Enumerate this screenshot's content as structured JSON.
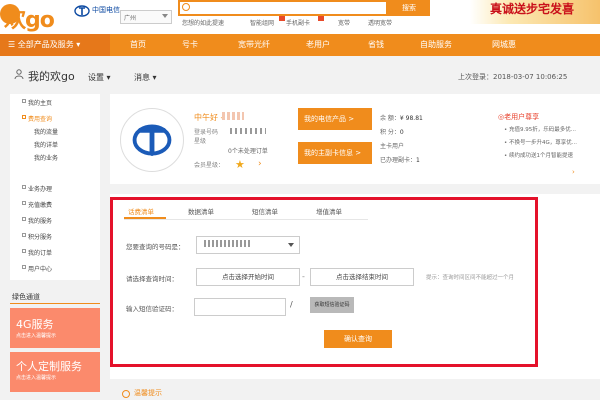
{
  "header": {
    "logo": "欢go",
    "carrier": "中国电信",
    "city": "广州",
    "search_button": "搜索",
    "hot_links": [
      "您想的如此提速",
      "智能组网",
      "手机副卡",
      "宽带",
      "透明宽带"
    ],
    "banner": "真诚送步宅发喜"
  },
  "nav": {
    "all_products": "全部产品及服务",
    "items": [
      "首页",
      "号卡",
      "宽带光纤",
      "老用户",
      "省钱",
      "自助服务",
      "网城惠"
    ]
  },
  "subheader": {
    "my_go": "我的欢go",
    "settings": "设置",
    "messages": "消息",
    "last_login": "上次登录：2018-03-07 10:06:25"
  },
  "sidebar": {
    "items": [
      "我的主页",
      "费用查询",
      "我的流量",
      "我的详单",
      "我的业务",
      "业务办理",
      "充值缴费",
      "我的服务",
      "积分服务",
      "我的订单",
      "用户中心"
    ],
    "active_index": 1,
    "green_channel": "绿色通道",
    "promos": [
      {
        "title": "4G服务",
        "subtitle": "点击进入温馨提示"
      },
      {
        "title": "个人定制服务",
        "subtitle": "点击进入温馨提示"
      }
    ]
  },
  "account": {
    "greeting": "中午好 - ",
    "login_id_label": "登录号码",
    "star_label": "星级",
    "pending": "个未处理订单",
    "pending_count": "0",
    "member_level": "会员星级：",
    "btn_products": "我的电信产品  >",
    "btn_card": "我的主副卡信息 >",
    "balance_label": "余  额：",
    "balance": "¥ 98.81",
    "points_label": "积  分：",
    "points": "0",
    "card_label": "主卡用户",
    "invoice_label": "已办理副卡：",
    "invoice_count": "1",
    "old_user_title": "◎老用户尊享",
    "old_user_items": [
      "• 充值9.95折，乐码最多优...",
      "• 不换号一步升4G，尊享优...",
      "• 续约成功送1个月智能提速"
    ],
    "more_arrow": "›"
  },
  "query": {
    "tabs": [
      "话费清单",
      "数据清单",
      "短信清单",
      "增值清单"
    ],
    "active_tab": 0,
    "number_label": "您要查询的号码是：",
    "date_label": "请选择查询时间：",
    "start_date": "点击选择开始时间",
    "end_date": "点击选择结束时间",
    "date_sep": "-",
    "hint": "提示：查询时间区间不能超过一个月",
    "sms_label": "输入短信验证码：",
    "get_code": "获取短信验证码",
    "confirm": "确认查询"
  },
  "footer": {
    "warm_tip": "温馨提示"
  },
  "colors": {
    "brand": "#f08c1c",
    "highlight_box": "#e4112a",
    "promo": "#fb8a6c"
  }
}
